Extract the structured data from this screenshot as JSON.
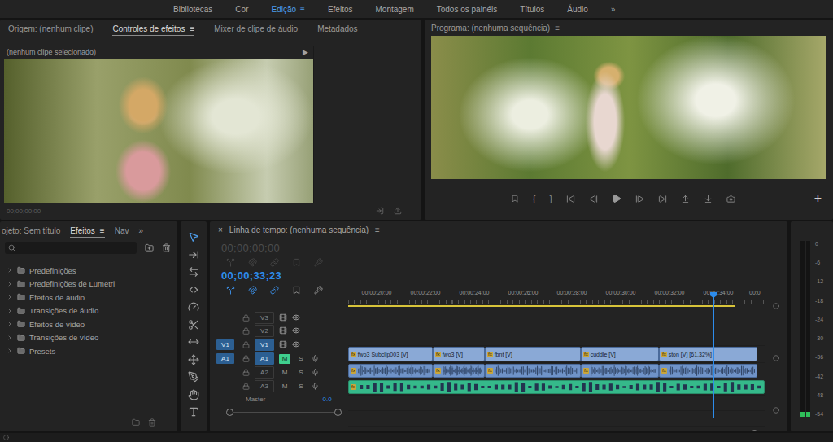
{
  "workspaces": {
    "items": [
      {
        "label": "Bibliotecas",
        "selected": false
      },
      {
        "label": "Cor",
        "selected": false
      },
      {
        "label": "Edição",
        "selected": true
      },
      {
        "label": "Efeitos",
        "selected": false
      },
      {
        "label": "Montagem",
        "selected": false
      },
      {
        "label": "Todos os painéis",
        "selected": false
      },
      {
        "label": "Títulos",
        "selected": false
      },
      {
        "label": "Áudio",
        "selected": false
      }
    ],
    "menu": "≡",
    "more": "»"
  },
  "source_panel": {
    "tabs": [
      {
        "label": "Origem: (nenhum clipe)",
        "selected": false
      },
      {
        "label": "Controles de efeitos",
        "selected": true
      },
      {
        "label": "Mixer de clipe de áudio",
        "selected": false
      },
      {
        "label": "Metadados",
        "selected": false
      }
    ],
    "menu": "≡",
    "subheader": "(nenhum clipe selecionado)",
    "expand": "▶",
    "timecode": "00;00;00;00"
  },
  "program_panel": {
    "title": "Programa: (nenhuma sequência)",
    "menu": "≡",
    "mark_in": "{",
    "mark_out": "}",
    "add": "+"
  },
  "project_panel": {
    "tabs": [
      {
        "label": "ojeto: Sem título",
        "selected": false
      },
      {
        "label": "Efeitos",
        "selected": true
      },
      {
        "label": "Nav",
        "selected": false
      }
    ],
    "menu": "≡",
    "more": "»",
    "items": [
      {
        "label": "Predefinições",
        "expanded": false
      },
      {
        "label": "Predefinições de Lumetri",
        "expanded": false
      },
      {
        "label": "Efeitos de áudio",
        "expanded": false
      },
      {
        "label": "Transições de áudio",
        "expanded": false
      },
      {
        "label": "Efeitos de vídeo",
        "expanded": false
      },
      {
        "label": "Transições de vídeo",
        "expanded": false
      },
      {
        "label": "Presets",
        "expanded": false
      }
    ]
  },
  "tools": [
    {
      "selected": true
    },
    {
      "selected": false
    },
    {
      "selected": false
    },
    {
      "selected": false
    },
    {
      "selected": false
    },
    {
      "selected": false
    },
    {
      "selected": false
    },
    {
      "selected": false
    },
    {
      "selected": false
    },
    {
      "selected": false
    },
    {
      "selected": false
    }
  ],
  "timeline": {
    "close": "×",
    "title": "Linha de tempo: (nenhuma sequência)",
    "menu": "≡",
    "headers": [
      {
        "timecode": "00;00;00;00",
        "disabled": true,
        "toggles": [
          false,
          false,
          false,
          false,
          false
        ]
      },
      {
        "timecode": "00;00;33;23",
        "disabled": false,
        "toggles": [
          true,
          true,
          true,
          false,
          false
        ]
      }
    ],
    "ruler": [
      "00;00;20;00",
      "00;00;22;00",
      "00;00;24;00",
      "00;00;26;00",
      "00;00;28;00",
      "00;00;30;00",
      "00;00;32;00",
      "00;00;34;00",
      "00;0"
    ],
    "fx": "fx",
    "mute": "M",
    "solo": "S",
    "tracks": [
      {
        "name": "V3",
        "kind": "video",
        "targeted": false,
        "patch": "",
        "clips": []
      },
      {
        "name": "V2",
        "kind": "video",
        "targeted": false,
        "patch": "",
        "clips": []
      },
      {
        "name": "V1",
        "kind": "video",
        "targeted": true,
        "patch": "V1",
        "clips": [
          {
            "label": "fwo3 Subclip003 [V]",
            "kind": "video",
            "fx": true
          },
          {
            "label": "fwo3 [V]",
            "kind": "video",
            "fx": true
          },
          {
            "label": "fbnt [V]",
            "kind": "video",
            "fx": true
          },
          {
            "label": "cuddle [V]",
            "kind": "video",
            "fx": true
          },
          {
            "label": "ston [V] [61.32%]",
            "kind": "video",
            "fx": true
          }
        ]
      },
      {
        "name": "A1",
        "kind": "audio",
        "targeted": true,
        "patch": "A1",
        "muted": true,
        "clips": [
          {
            "kind": "audio",
            "fx": true
          },
          {
            "kind": "audio",
            "fx": true
          },
          {
            "kind": "audio",
            "fx": true
          },
          {
            "kind": "audio",
            "fx": true
          },
          {
            "kind": "audio",
            "fx": true
          }
        ]
      },
      {
        "name": "A2",
        "kind": "audio",
        "targeted": false,
        "patch": "",
        "muted": false,
        "clips": [
          {
            "kind": "music",
            "fx": true
          }
        ]
      },
      {
        "name": "A3",
        "kind": "audio",
        "targeted": false,
        "patch": "",
        "muted": false,
        "clips": []
      }
    ],
    "master": {
      "name": "Master",
      "value": "0.0"
    }
  },
  "meter": {
    "scale": [
      "0",
      "-6",
      "-12",
      "-18",
      "-24",
      "-30",
      "-36",
      "-42",
      "-48",
      "-54"
    ],
    "channels": [
      {
        "level": 0.03
      },
      {
        "level": 0.03
      }
    ]
  }
}
